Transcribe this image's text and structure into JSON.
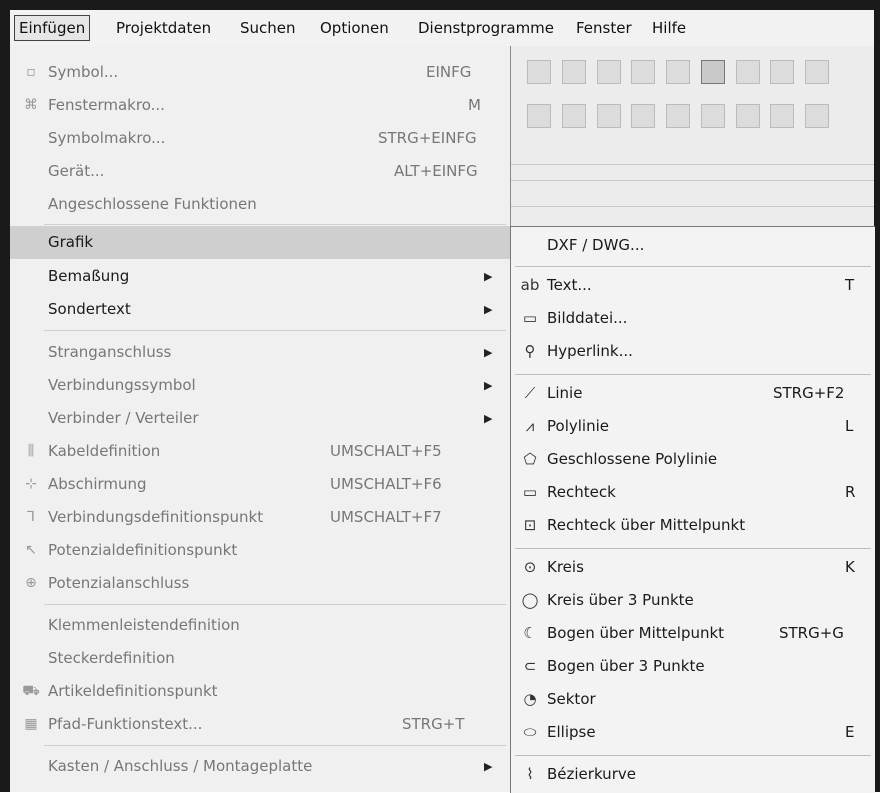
{
  "menubar": {
    "items": [
      {
        "label": "Einfügen",
        "active": true
      },
      {
        "label": "Projektdaten"
      },
      {
        "label": "Suchen"
      },
      {
        "label": "Optionen"
      },
      {
        "label": "Dienstprogramme"
      },
      {
        "label": "Fenster"
      },
      {
        "label": "Hilfe"
      }
    ]
  },
  "insert_menu": {
    "items": [
      {
        "label": "Symbol...",
        "shortcut": "EINFG",
        "icon": "symbol-icon"
      },
      {
        "label": "Fenstermakro...",
        "shortcut": "M",
        "icon": "window-macro-icon"
      },
      {
        "label": "Symbolmakro...",
        "shortcut": "STRG+EINFG"
      },
      {
        "label": "Gerät...",
        "shortcut": "ALT+EINFG"
      },
      {
        "label": "Angeschlossene Funktionen"
      },
      {
        "label": "Grafik"
      },
      {
        "label": "Bemaßung"
      },
      {
        "label": "Sondertext"
      },
      {
        "label": "Stranganschluss"
      },
      {
        "label": "Verbindungssymbol"
      },
      {
        "label": "Verbinder / Verteiler"
      },
      {
        "label": "Kabeldefinition",
        "shortcut": "UMSCHALT+F5",
        "icon": "cable-definition-icon"
      },
      {
        "label": "Abschirmung",
        "shortcut": "UMSCHALT+F6",
        "icon": "shielding-icon"
      },
      {
        "label": "Verbindungsdefinitionspunkt",
        "shortcut": "UMSCHALT+F7",
        "icon": "connection-definition-point-icon"
      },
      {
        "label": "Potenzialdefinitionspunkt",
        "icon": "potential-definition-point-icon"
      },
      {
        "label": "Potenzialanschluss",
        "icon": "potential-connection-icon"
      },
      {
        "label": "Klemmenleistendefinition"
      },
      {
        "label": "Steckerdefinition"
      },
      {
        "label": "Artikeldefinitionspunkt",
        "icon": "article-definition-point-icon"
      },
      {
        "label": "Pfad-Funktionstext...",
        "shortcut": "STRG+T",
        "icon": "path-function-text-icon"
      },
      {
        "label": "Kasten / Anschluss / Montageplatte"
      }
    ]
  },
  "graphic_submenu": {
    "items": [
      {
        "label": "DXF / DWG..."
      },
      {
        "label": "Text...",
        "shortcut": "T",
        "icon": "text-icon",
        "icon_glyph": "ab"
      },
      {
        "label": "Bilddatei...",
        "icon": "image-file-icon"
      },
      {
        "label": "Hyperlink...",
        "icon": "hyperlink-icon"
      },
      {
        "label": "Linie",
        "shortcut": "STRG+F2",
        "icon": "line-icon"
      },
      {
        "label": "Polylinie",
        "shortcut": "L",
        "icon": "polyline-icon"
      },
      {
        "label": "Geschlossene Polylinie",
        "icon": "closed-polyline-icon"
      },
      {
        "label": "Rechteck",
        "shortcut": "R",
        "icon": "rectangle-icon"
      },
      {
        "label": "Rechteck über Mittelpunkt",
        "icon": "rectangle-center-icon"
      },
      {
        "label": "Kreis",
        "shortcut": "K",
        "icon": "circle-icon"
      },
      {
        "label": "Kreis über 3 Punkte",
        "icon": "circle-3-points-icon"
      },
      {
        "label": "Bogen über Mittelpunkt",
        "shortcut": "STRG+G",
        "icon": "arc-center-icon"
      },
      {
        "label": "Bogen über 3 Punkte",
        "icon": "arc-3-points-icon"
      },
      {
        "label": "Sektor",
        "icon": "sector-icon"
      },
      {
        "label": "Ellipse",
        "shortcut": "E",
        "icon": "ellipse-icon"
      },
      {
        "label": "Bézierkurve",
        "icon": "bezier-curve-icon"
      }
    ]
  }
}
